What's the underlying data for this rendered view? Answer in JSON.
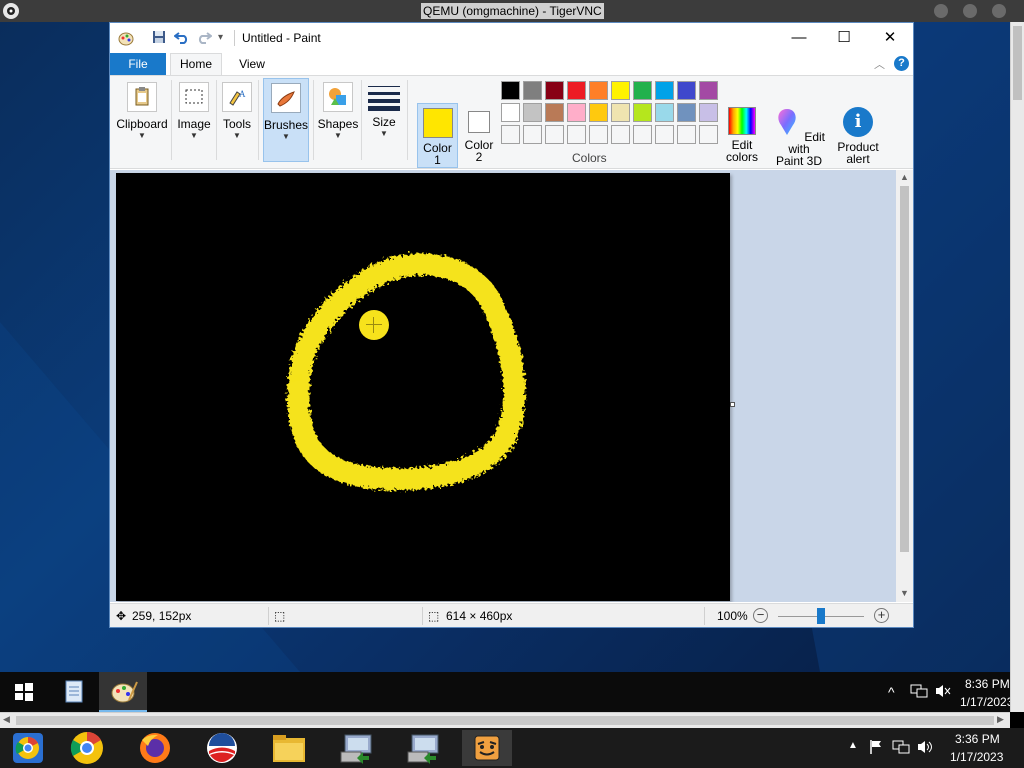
{
  "vnc": {
    "title": "QEMU (omgmachine) - TigerVNC"
  },
  "paint": {
    "window_title": "Untitled - Paint",
    "tabs": {
      "file": "File",
      "home": "Home",
      "view": "View"
    },
    "groups": {
      "clipboard": "Clipboard",
      "image": "Image",
      "tools": "Tools",
      "brushes": "Brushes",
      "shapes": "Shapes",
      "size": "Size"
    },
    "color1": {
      "line1": "Color",
      "line2": "1",
      "value": "#ffe600"
    },
    "color2": {
      "line1": "Color",
      "line2": "2",
      "value": "#ffffff"
    },
    "colors_label": "Colors",
    "edit_colors": {
      "line1": "Edit",
      "line2": "colors"
    },
    "paint3d": {
      "line1": "Edit with",
      "line2": "Paint 3D"
    },
    "product_alert": {
      "line1": "Product",
      "line2": "alert"
    },
    "palette": [
      "#000000",
      "#7f7f7f",
      "#880015",
      "#ed1c24",
      "#ff7f27",
      "#fff200",
      "#22b14c",
      "#00a2e8",
      "#3f48cc",
      "#a349a4",
      "#ffffff",
      "#c3c3c3",
      "#b97a57",
      "#ffaec9",
      "#ffc90e",
      "#efe4b0",
      "#b5e61d",
      "#99d9ea",
      "#7092be",
      "#c8bfe7",
      "#ffffff",
      "#ffffff",
      "#ffffff",
      "#ffffff",
      "#ffffff",
      "#ffffff",
      "#ffffff",
      "#ffffff",
      "#ffffff",
      "#ffffff"
    ],
    "status": {
      "cursor_pos": "259, 152px",
      "canvas_size": "614 × 460px",
      "zoom": "100%"
    }
  },
  "guest_clock": {
    "time": "8:36 PM",
    "date": "1/17/2023"
  },
  "host_clock": {
    "time": "3:36 PM",
    "date": "1/17/2023"
  }
}
